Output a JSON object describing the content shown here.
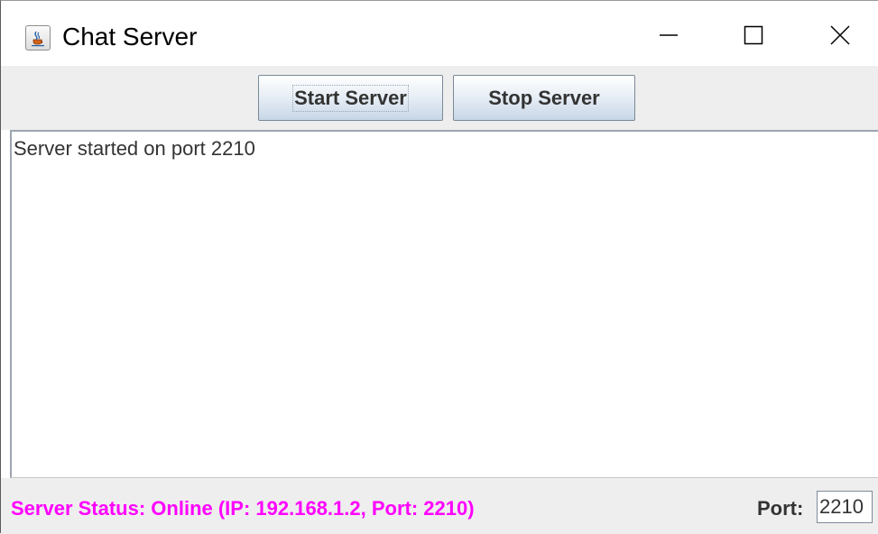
{
  "window": {
    "title": "Chat Server",
    "app_icon": "java-cup-icon",
    "controls": {
      "minimize_icon": "minimize-icon",
      "maximize_icon": "maximize-icon",
      "close_icon": "close-icon"
    }
  },
  "toolbar": {
    "start_label": "Start Server",
    "stop_label": "Stop Server"
  },
  "log": {
    "lines": [
      "Server started on port 2210"
    ]
  },
  "status": {
    "text": "Server Status: Online (IP: 192.168.1.2, Port: 2210)",
    "color": "#ff00ff",
    "port_label": "Port:",
    "port_value": "2210"
  }
}
